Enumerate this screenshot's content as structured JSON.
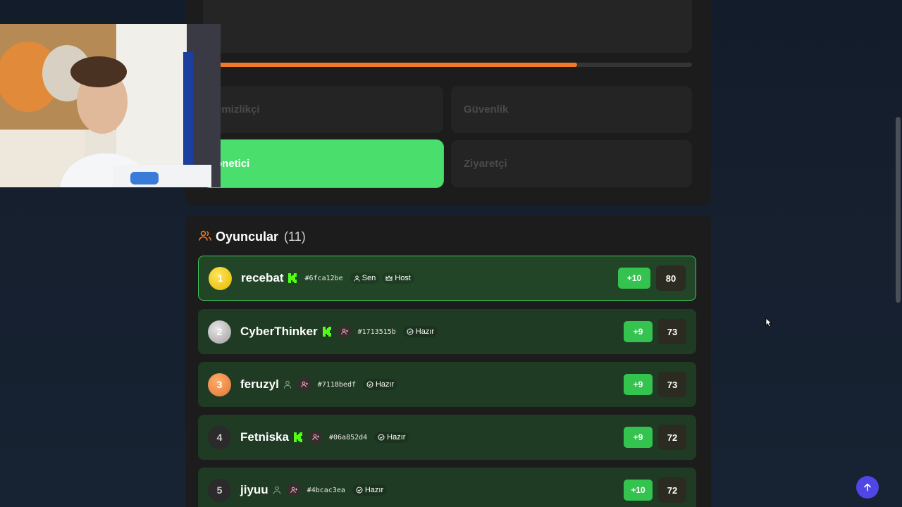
{
  "progress": {
    "fraction": 0.765
  },
  "roles": [
    {
      "label": "emizlikçi"
    },
    {
      "label": "Güvenlik"
    },
    {
      "label": "önetici"
    },
    {
      "label": "Ziyaretçi"
    }
  ],
  "players": {
    "title": "Oyuncular",
    "count": "(11)",
    "rows": [
      {
        "rank": "1",
        "name": "recebat",
        "id": "#6fca12be",
        "chip1": "Sen",
        "chip2": "Host",
        "delta": "+10",
        "score": "80"
      },
      {
        "rank": "2",
        "name": "CyberThinker",
        "id": "#1713515b",
        "chip1": "Hazır",
        "delta": "+9",
        "score": "73"
      },
      {
        "rank": "3",
        "name": "feruzyl",
        "id": "#7118bedf",
        "chip1": "Hazır",
        "delta": "+9",
        "score": "73"
      },
      {
        "rank": "4",
        "name": "Fetniska",
        "id": "#06a852d4",
        "chip1": "Hazır",
        "delta": "+9",
        "score": "72"
      },
      {
        "rank": "5",
        "name": "jiyuu",
        "id": "#4bcac3ea",
        "chip1": "Hazır",
        "delta": "+10",
        "score": "72"
      }
    ]
  },
  "colors": {
    "accent_orange": "#f07a28",
    "selected_green": "#4ade6d",
    "row_green": "#1f3b23",
    "delta_green": "#35c34f",
    "scroll_button": "#4f46e5"
  },
  "icons": {
    "players": "users-icon",
    "kick": "kick-k-icon",
    "you": "user-icon",
    "host": "crown-icon",
    "ready": "check-circle-icon",
    "friend": "user-plus-icon",
    "scroll_top": "arrow-up-icon"
  }
}
